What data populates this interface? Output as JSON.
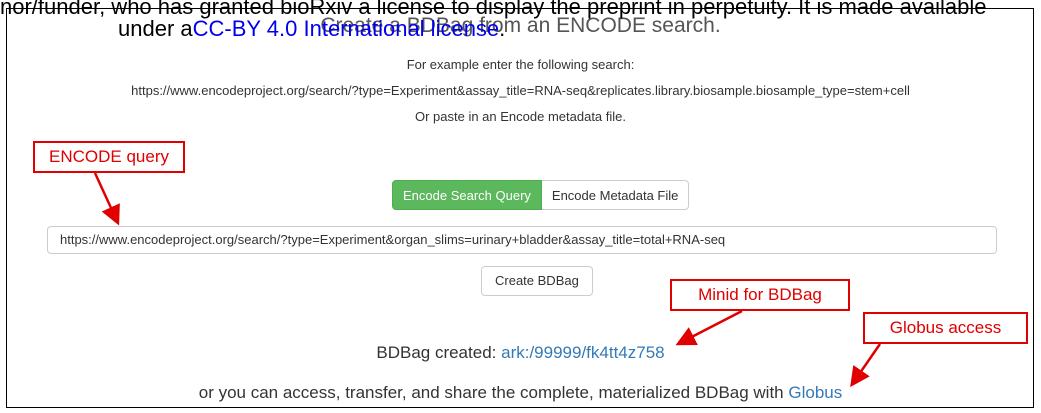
{
  "watermark": {
    "line1": "nor/funder, who has granted bioRxiv a license to display the preprint in perpetuity. It is made available",
    "line2_prefix": "under a",
    "line2_link": "CC-BY 4.0 International license",
    "line2_suffix": "."
  },
  "page": {
    "title": "Create a BDBag from an ENCODE search.",
    "example_intro": "For example enter the following search:",
    "example_url": "https://www.encodeproject.org/search/?type=Experiment&assay_title=RNA-seq&replicates.library.biosample.biosample_type=stem+cell",
    "or_paste": "Or paste in an Encode metadata file."
  },
  "tabs": [
    {
      "label": "Encode Search Query",
      "active": true
    },
    {
      "label": "Encode Metadata File",
      "active": false
    }
  ],
  "query_input": {
    "value": "https://www.encodeproject.org/search/?type=Experiment&organ_slims=urinary+bladder&assay_title=total+RNA-seq"
  },
  "create_button": {
    "label": "Create BDBag"
  },
  "result": {
    "created_prefix": "BDBag created: ",
    "minid_link": "ark:/99999/fk4tt4z758",
    "access_prefix": "or you can access, transfer, and share the complete, materialized BDBag with ",
    "globus_link": "Globus"
  },
  "callouts": {
    "encode_query": "ENCODE query",
    "minid": "Minid for BDBag",
    "globus": "Globus access"
  },
  "colors": {
    "accent_green": "#5cb85c",
    "link_blue": "#337ab7",
    "callout_red": "#e00000"
  }
}
